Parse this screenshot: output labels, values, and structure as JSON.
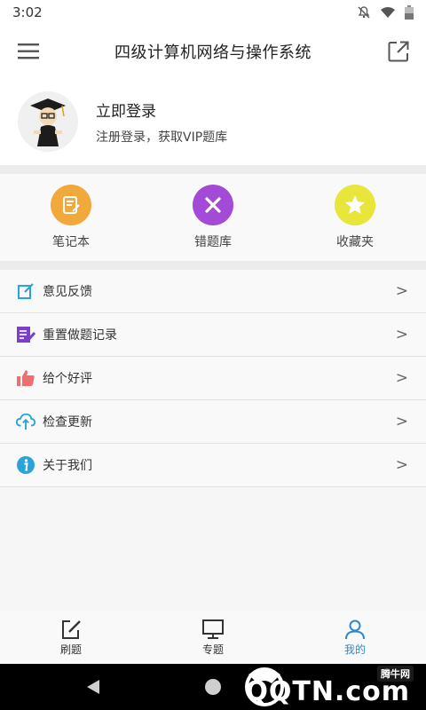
{
  "status": {
    "time": "3:02"
  },
  "header": {
    "title": "四级计算机网络与操作系统"
  },
  "profile": {
    "title": "立即登录",
    "subtitle": "注册登录，获取VIP题库"
  },
  "quick_actions": [
    {
      "label": "笔记本",
      "icon": "notebook-icon",
      "color": "#f2a93b"
    },
    {
      "label": "错题库",
      "icon": "close-icon",
      "color": "#a34bd6"
    },
    {
      "label": "收藏夹",
      "icon": "star-icon",
      "color": "#e8e63a"
    }
  ],
  "menu": [
    {
      "label": "意见反馈",
      "icon": "edit-icon",
      "color": "#2aa3d8"
    },
    {
      "label": "重置做题记录",
      "icon": "document-edit-icon",
      "color": "#7b3fc9"
    },
    {
      "label": "给个好评",
      "icon": "thumbs-up-icon",
      "color": "#f06e6e"
    },
    {
      "label": "检查更新",
      "icon": "cloud-upload-icon",
      "color": "#2aa3d8"
    },
    {
      "label": "关于我们",
      "icon": "info-icon",
      "color": "#2aa3d8"
    }
  ],
  "bottom_nav": [
    {
      "label": "刷题",
      "icon": "pencil-icon"
    },
    {
      "label": "专题",
      "icon": "monitor-icon"
    },
    {
      "label": "我的",
      "icon": "user-icon",
      "active": true
    }
  ],
  "colors": {
    "accent": "#2f88d0"
  },
  "watermark": {
    "cn": "腾牛网",
    "en": "QQTN.com"
  }
}
